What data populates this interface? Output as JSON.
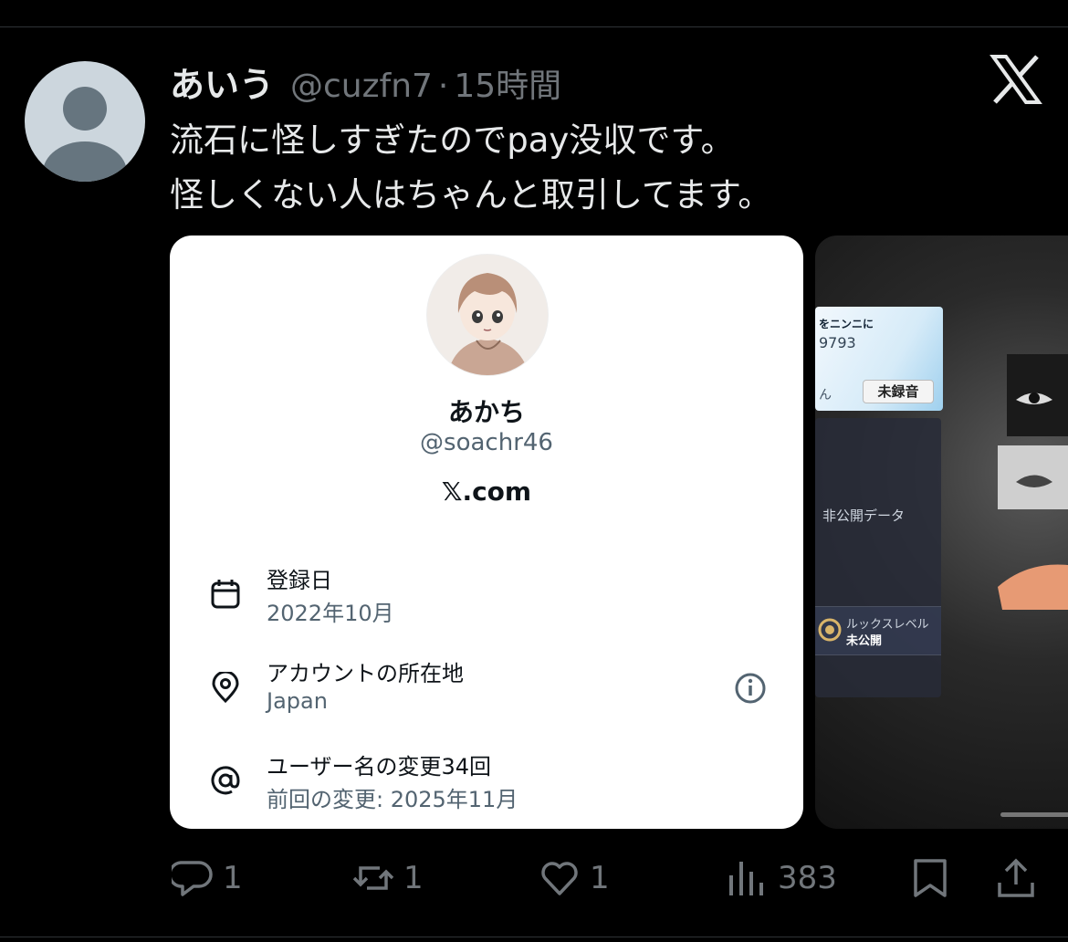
{
  "tweet": {
    "author_name": "あいう",
    "author_handle": "@cuzfn7",
    "separator": "·",
    "time_ago": "15時間",
    "text_lines": [
      "流石に怪しすぎたのでpay没収です。",
      "怪しくない人はちゃんと取引してます。"
    ]
  },
  "profile_card": {
    "name": "あかち",
    "handle": "@soachr46",
    "site": "𝕏.com",
    "rows": [
      {
        "label": "登録日",
        "value": "2022年10月",
        "icon": "calendar-icon"
      },
      {
        "label": "アカウントの所在地",
        "value": "Japan",
        "icon": "location-pin-icon"
      },
      {
        "label": "ユーザー名の変更34回",
        "value": "前回の変更: 2025年11月",
        "icon": "at-sign-icon"
      }
    ]
  },
  "second_image": {
    "panel_title": "をニンニに",
    "panel_number": "9793",
    "panel_suffix": "ん",
    "unrecorded": "未録音",
    "private_data": "非公開データ",
    "looks_level": "ルックスレベル",
    "looks_private": "未公開"
  },
  "actions": {
    "replies": "1",
    "reposts": "1",
    "likes": "1",
    "views": "383"
  },
  "colors": {
    "background": "#000000",
    "text_primary": "#e7e9ea",
    "text_secondary": "#71767b",
    "card_bg": "#ffffff"
  }
}
